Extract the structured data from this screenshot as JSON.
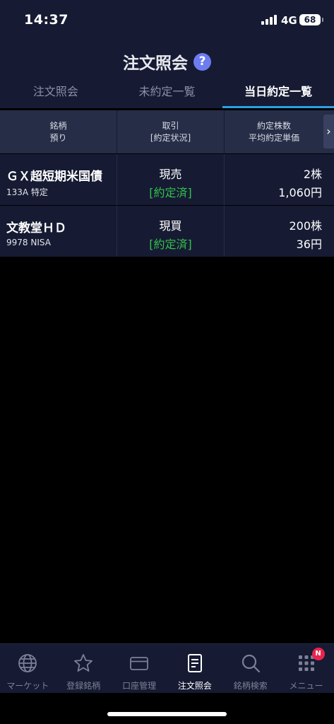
{
  "status_bar": {
    "time": "14:37",
    "network": "4G",
    "battery": "68"
  },
  "header": {
    "title": "注文照会",
    "help": "?"
  },
  "tabs": [
    {
      "label": "注文照会",
      "active": false
    },
    {
      "label": "未約定一覧",
      "active": false
    },
    {
      "label": "当日約定一覧",
      "active": true
    }
  ],
  "table": {
    "headers": [
      {
        "line1": "銘柄",
        "line2": "預り"
      },
      {
        "line1": "取引",
        "line2": "[約定状況]"
      },
      {
        "line1": "約定株数",
        "line2": "平均約定単価"
      }
    ],
    "scroll_arrow": "›",
    "rows": [
      {
        "name": "ＧＸ超短期米国債",
        "sub": "133A 特定",
        "trade": "現売",
        "status": "[約定済]",
        "qty": "2株",
        "price": "1,060円"
      },
      {
        "name": "文教堂ＨＤ",
        "sub": "9978 NISA",
        "trade": "現買",
        "status": "[約定済]",
        "qty": "200株",
        "price": "36円"
      }
    ]
  },
  "bottom_nav": {
    "items": [
      {
        "label": "マーケット",
        "icon": "globe-icon"
      },
      {
        "label": "登録銘柄",
        "icon": "star-icon"
      },
      {
        "label": "口座管理",
        "icon": "card-icon"
      },
      {
        "label": "注文照会",
        "icon": "document-icon",
        "active": true
      },
      {
        "label": "銘柄検索",
        "icon": "search-icon"
      },
      {
        "label": "メニュー",
        "icon": "grid-menu-icon"
      }
    ],
    "badge": "N"
  },
  "colors": {
    "panel": "#161b33",
    "header_row": "#262d47",
    "accent_blue": "#2e9fe6",
    "status_green": "#33c14a",
    "help_purple": "#6c7df0",
    "badge_red": "#e8244f"
  }
}
